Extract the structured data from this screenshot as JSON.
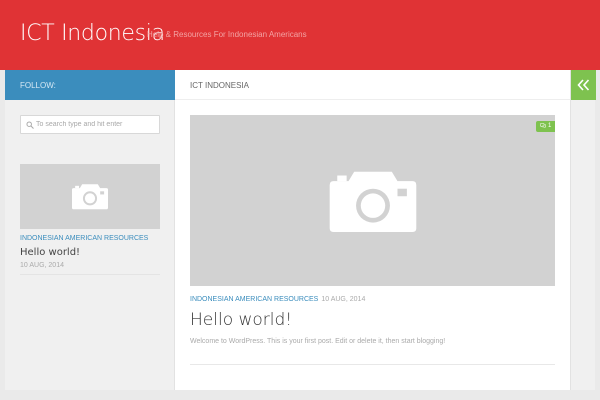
{
  "header": {
    "site_title": "ICT Indonesia",
    "tagline": "Help & Resources For Indonesian Americans",
    "background_color": "#e03335"
  },
  "sidebar": {
    "follow_label": "FOLLOW:",
    "follow_bar_color": "#3b8dbd",
    "search": {
      "placeholder": "To search type and hit enter",
      "value": ""
    },
    "post": {
      "category": "INDONESIAN AMERICAN RESOURCES",
      "title": "Hello world!",
      "date": "10 AUG, 2014",
      "thumbnail_icon": "camera-icon"
    }
  },
  "main": {
    "breadcrumb": "ICT INDONESIA",
    "post": {
      "comment_count": "1",
      "category": "INDONESIAN AMERICAN RESOURCES",
      "date": "10 AUG, 2014",
      "title": "Hello world!",
      "excerpt": "Welcome to WordPress. This is your first post. Edit or delete it, then start blogging!",
      "thumbnail_icon": "camera-icon"
    }
  },
  "sidebar_toggle": {
    "icon": "double-chevron-left-icon",
    "color": "#7ec24f"
  },
  "colors": {
    "accent_blue": "#3b8dbd",
    "accent_green": "#7ec24f",
    "placeholder_gray": "#d2d2d2"
  }
}
